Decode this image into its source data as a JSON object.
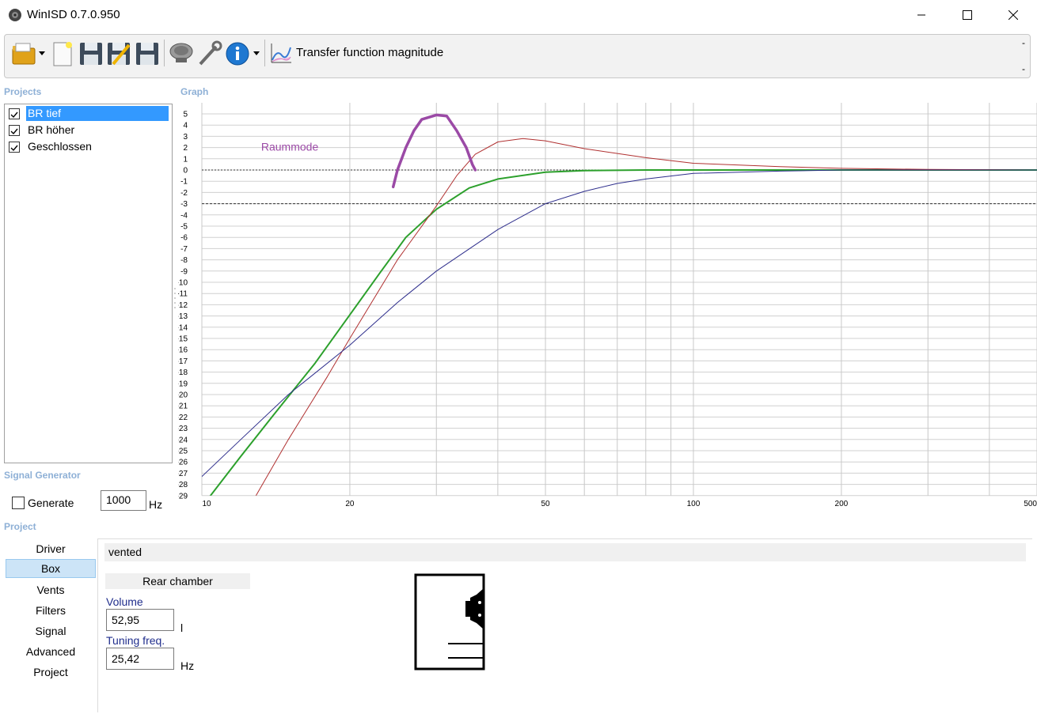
{
  "window": {
    "title": "WinISD 0.7.0.950",
    "controls": [
      "minimize-icon",
      "maximize-icon",
      "close-icon"
    ]
  },
  "toolbar": {
    "buttons": [
      "open-folder-icon",
      "dropdown-arrow-icon",
      "new-document-icon",
      "save-icon",
      "save-as-icon",
      "save-all-icon",
      "driver-icon",
      "tools-wrench-icon",
      "info-icon",
      "dropdown-arrow-icon"
    ],
    "graph_type_label": "Transfer function magnitude",
    "right_markers": [
      "-",
      "-"
    ]
  },
  "projects": {
    "label": "Projects",
    "items": [
      {
        "label": "BR tief",
        "checked": true,
        "selected": true
      },
      {
        "label": "BR höher",
        "checked": true,
        "selected": false
      },
      {
        "label": "Geschlossen",
        "checked": true,
        "selected": false
      }
    ]
  },
  "signal_generator": {
    "label": "Signal Generator",
    "generate_label": "Generate",
    "generate_checked": false,
    "frequency": "1000",
    "unit": "Hz"
  },
  "graph": {
    "label": "Graph",
    "annotation": "Raummode",
    "annotation_color": "#9b4aa6",
    "chart_data": {
      "type": "line",
      "title": "",
      "xscale": "log",
      "xlim": [
        10,
        500
      ],
      "ylim": [
        -29,
        5
      ],
      "y_ticks": [
        5,
        4,
        3,
        2,
        1,
        0,
        -1,
        -2,
        -3,
        -4,
        -5,
        -6,
        -7,
        -8,
        -9,
        -10,
        -11,
        -12,
        -13,
        -14,
        -15,
        -16,
        -17,
        -18,
        -19,
        -20,
        -21,
        -22,
        -23,
        -24,
        -25,
        -26,
        -27,
        -28,
        -29
      ],
      "x_tick_labels": [
        "10",
        "20",
        "50",
        "100",
        "200",
        "500"
      ],
      "x_tick_values": [
        10,
        20,
        50,
        100,
        200,
        500
      ],
      "reference_lines": [
        0,
        -3
      ],
      "grid": true,
      "series": [
        {
          "color": "#2ca02c",
          "x": [
            10,
            12,
            14,
            17,
            20,
            23,
            26,
            30,
            35,
            40,
            50,
            60,
            80,
            100,
            150,
            200,
            300,
            500
          ],
          "y": [
            -30,
            -25.5,
            -21.8,
            -17.2,
            -12.9,
            -9.2,
            -6,
            -3.5,
            -1.6,
            -0.8,
            -0.2,
            -0.05,
            0,
            0,
            0,
            0,
            0,
            0
          ]
        },
        {
          "color": "#b03030",
          "x": [
            12.5,
            15,
            18,
            20,
            25,
            30,
            33,
            36,
            40,
            45,
            50,
            60,
            80,
            100,
            150,
            200,
            300,
            500
          ],
          "y": [
            -30,
            -24,
            -18.4,
            -15,
            -8,
            -3.2,
            -0.5,
            1.4,
            2.5,
            2.8,
            2.6,
            1.9,
            1.1,
            0.6,
            0.3,
            0.15,
            0.05,
            0
          ]
        },
        {
          "color": "#2e2e8c",
          "x": [
            10,
            12,
            15,
            20,
            25,
            30,
            40,
            50,
            60,
            70,
            80,
            100,
            150,
            200,
            300,
            500
          ],
          "y": [
            -27.3,
            -24,
            -20,
            -15.6,
            -11.8,
            -9,
            -5.3,
            -3,
            -1.9,
            -1.2,
            -0.8,
            -0.3,
            -0.1,
            0,
            0,
            0
          ]
        },
        {
          "color": "#9b4aa6",
          "x": [
            24.5,
            25,
            26,
            27,
            28,
            30,
            31.5,
            33,
            34.5,
            35.5,
            36
          ],
          "y": [
            -1.5,
            0,
            2,
            3.5,
            4.5,
            4.9,
            4.8,
            3.5,
            2,
            0.5,
            0
          ]
        }
      ]
    }
  },
  "project_panel": {
    "label": "Project",
    "tabs": [
      "Driver",
      "Box",
      "Vents",
      "Filters",
      "Signal",
      "Advanced",
      "Project"
    ],
    "selected_tab": "Box",
    "box_type": "vented",
    "rear_chamber_label": "Rear chamber",
    "volume_label": "Volume",
    "volume_value": "52,95",
    "volume_unit": "l",
    "tuning_label": "Tuning freq.",
    "tuning_value": "25,42",
    "tuning_unit": "Hz"
  }
}
